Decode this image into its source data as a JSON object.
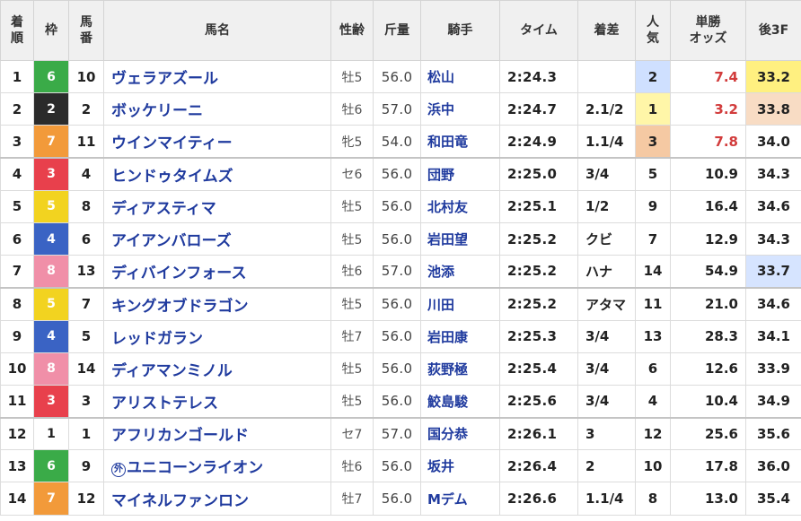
{
  "header": {
    "rank_l1": "着",
    "rank_l2": "順",
    "waku": "枠",
    "num_l1": "馬",
    "num_l2": "番",
    "name": "馬名",
    "age": "性齢",
    "weight": "斤量",
    "jockey": "騎手",
    "time": "タイム",
    "margin": "着差",
    "pop_l1": "人",
    "pop_l2": "気",
    "odds_l1": "単勝",
    "odds_l2": "オッズ",
    "last3f": "後3F"
  },
  "waku_colors": {
    "1": {
      "bg": "#ffffff",
      "fg": "#222222"
    },
    "2": {
      "bg": "#2b2b2b",
      "fg": "#ffffff"
    },
    "3": {
      "bg": "#e8404c",
      "fg": "#ffffff"
    },
    "4": {
      "bg": "#3a63c4",
      "fg": "#ffffff"
    },
    "5": {
      "bg": "#f2d320",
      "fg": "#ffffff"
    },
    "6": {
      "bg": "#3aab48",
      "fg": "#ffffff"
    },
    "7": {
      "bg": "#f29a3a",
      "fg": "#ffffff"
    },
    "8": {
      "bg": "#f08fa8",
      "fg": "#ffffff"
    }
  },
  "highlight_colors": {
    "pop1": "#fff6a8",
    "pop2": "#cfe0ff",
    "pop3": "#f5c9a3",
    "last3f_1": "#fff080",
    "last3f_2": "#f8dcc4",
    "last3f_3": "#d6e4ff",
    "odds_fav": "#d23c3c"
  },
  "rows": [
    {
      "rank": "1",
      "waku": "6",
      "num": "10",
      "name": "ヴェラアズール",
      "foreign": false,
      "age": "牡5",
      "weight": "56.0",
      "jockey": "松山",
      "time": "2:24.3",
      "margin": "",
      "pop": "2",
      "odds": "7.4",
      "last3f": "33.2",
      "pop_hl": "pop2",
      "odds_red": true,
      "last3f_hl": "last3f_1"
    },
    {
      "rank": "2",
      "waku": "2",
      "num": "2",
      "name": "ボッケリーニ",
      "foreign": false,
      "age": "牡6",
      "weight": "57.0",
      "jockey": "浜中",
      "time": "2:24.7",
      "margin": "2.1/2",
      "pop": "1",
      "odds": "3.2",
      "last3f": "33.8",
      "pop_hl": "pop1",
      "odds_red": true,
      "last3f_hl": "last3f_2"
    },
    {
      "rank": "3",
      "waku": "7",
      "num": "11",
      "name": "ウインマイティー",
      "foreign": false,
      "age": "牝5",
      "weight": "54.0",
      "jockey": "和田竜",
      "time": "2:24.9",
      "margin": "1.1/4",
      "pop": "3",
      "odds": "7.8",
      "last3f": "34.0",
      "pop_hl": "pop3",
      "odds_red": true,
      "last3f_hl": ""
    },
    {
      "rank": "4",
      "waku": "3",
      "num": "4",
      "name": "ヒンドゥタイムズ",
      "foreign": false,
      "age": "セ6",
      "weight": "56.0",
      "jockey": "団野",
      "time": "2:25.0",
      "margin": "3/4",
      "pop": "5",
      "odds": "10.9",
      "last3f": "34.3",
      "pop_hl": "",
      "odds_red": false,
      "last3f_hl": ""
    },
    {
      "rank": "5",
      "waku": "5",
      "num": "8",
      "name": "ディアスティマ",
      "foreign": false,
      "age": "牡5",
      "weight": "56.0",
      "jockey": "北村友",
      "time": "2:25.1",
      "margin": "1/2",
      "pop": "9",
      "odds": "16.4",
      "last3f": "34.6",
      "pop_hl": "",
      "odds_red": false,
      "last3f_hl": ""
    },
    {
      "rank": "6",
      "waku": "4",
      "num": "6",
      "name": "アイアンバローズ",
      "foreign": false,
      "age": "牡5",
      "weight": "56.0",
      "jockey": "岩田望",
      "time": "2:25.2",
      "margin": "クビ",
      "pop": "7",
      "odds": "12.9",
      "last3f": "34.3",
      "pop_hl": "",
      "odds_red": false,
      "last3f_hl": ""
    },
    {
      "rank": "7",
      "waku": "8",
      "num": "13",
      "name": "ディバインフォース",
      "foreign": false,
      "age": "牡6",
      "weight": "57.0",
      "jockey": "池添",
      "time": "2:25.2",
      "margin": "ハナ",
      "pop": "14",
      "odds": "54.9",
      "last3f": "33.7",
      "pop_hl": "",
      "odds_red": false,
      "last3f_hl": "last3f_3"
    },
    {
      "rank": "8",
      "waku": "5",
      "num": "7",
      "name": "キングオブドラゴン",
      "foreign": false,
      "age": "牡5",
      "weight": "56.0",
      "jockey": "川田",
      "time": "2:25.2",
      "margin": "アタマ",
      "pop": "11",
      "odds": "21.0",
      "last3f": "34.6",
      "pop_hl": "",
      "odds_red": false,
      "last3f_hl": ""
    },
    {
      "rank": "9",
      "waku": "4",
      "num": "5",
      "name": "レッドガラン",
      "foreign": false,
      "age": "牡7",
      "weight": "56.0",
      "jockey": "岩田康",
      "time": "2:25.3",
      "margin": "3/4",
      "pop": "13",
      "odds": "28.3",
      "last3f": "34.1",
      "pop_hl": "",
      "odds_red": false,
      "last3f_hl": ""
    },
    {
      "rank": "10",
      "waku": "8",
      "num": "14",
      "name": "ディアマンミノル",
      "foreign": false,
      "age": "牡5",
      "weight": "56.0",
      "jockey": "荻野極",
      "time": "2:25.4",
      "margin": "3/4",
      "pop": "6",
      "odds": "12.6",
      "last3f": "33.9",
      "pop_hl": "",
      "odds_red": false,
      "last3f_hl": ""
    },
    {
      "rank": "11",
      "waku": "3",
      "num": "3",
      "name": "アリストテレス",
      "foreign": false,
      "age": "牡5",
      "weight": "56.0",
      "jockey": "鮫島駿",
      "time": "2:25.6",
      "margin": "3/4",
      "pop": "4",
      "odds": "10.4",
      "last3f": "34.9",
      "pop_hl": "",
      "odds_red": false,
      "last3f_hl": ""
    },
    {
      "rank": "12",
      "waku": "1",
      "num": "1",
      "name": "アフリカンゴールド",
      "foreign": false,
      "age": "セ7",
      "weight": "57.0",
      "jockey": "国分恭",
      "time": "2:26.1",
      "margin": "3",
      "pop": "12",
      "odds": "25.6",
      "last3f": "35.6",
      "pop_hl": "",
      "odds_red": false,
      "last3f_hl": ""
    },
    {
      "rank": "13",
      "waku": "6",
      "num": "9",
      "name": "ユニコーンライオン",
      "foreign": true,
      "foreign_mark": "外",
      "age": "牡6",
      "weight": "56.0",
      "jockey": "坂井",
      "time": "2:26.4",
      "margin": "2",
      "pop": "10",
      "odds": "17.8",
      "last3f": "36.0",
      "pop_hl": "",
      "odds_red": false,
      "last3f_hl": ""
    },
    {
      "rank": "14",
      "waku": "7",
      "num": "12",
      "name": "マイネルファンロン",
      "foreign": false,
      "age": "牡7",
      "weight": "56.0",
      "jockey": "Mデム",
      "time": "2:26.6",
      "margin": "1.1/4",
      "pop": "8",
      "odds": "13.0",
      "last3f": "35.4",
      "pop_hl": "",
      "odds_red": false,
      "last3f_hl": ""
    }
  ]
}
